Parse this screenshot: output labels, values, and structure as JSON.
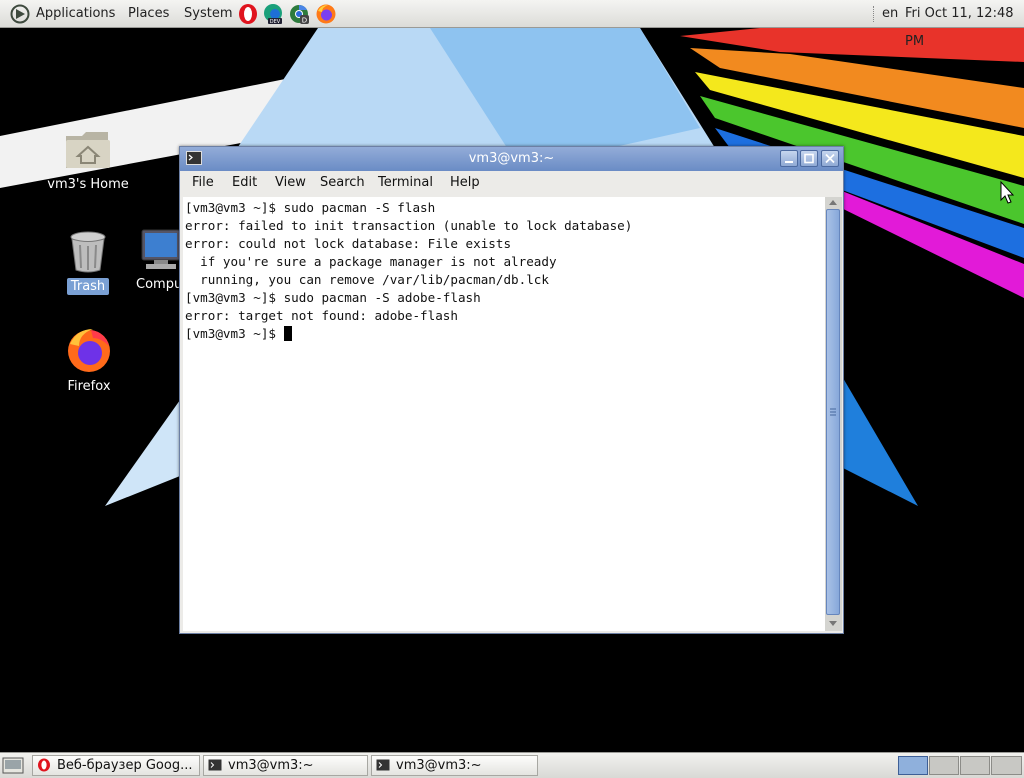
{
  "top_panel": {
    "menus": [
      "Applications",
      "Places",
      "System"
    ],
    "launchers": [
      "opera-icon",
      "edge-dev-icon",
      "chrome-dev-icon",
      "firefox-icon"
    ],
    "keyboard_layout": "en",
    "clock": "Fri Oct 11, 12:48 PM"
  },
  "desktop": {
    "icons": [
      {
        "label": "vm3's Home",
        "icon": "home-folder-icon"
      },
      {
        "label": "Trash",
        "icon": "trash-icon"
      },
      {
        "label": "Compu",
        "icon": "computer-icon"
      },
      {
        "label": "Firefox",
        "icon": "firefox-icon"
      }
    ]
  },
  "terminal": {
    "title": "vm3@vm3:~",
    "menu": [
      "File",
      "Edit",
      "View",
      "Search",
      "Terminal",
      "Help"
    ],
    "lines": [
      "[vm3@vm3 ~]$ sudo pacman -S flash",
      "error: failed to init transaction (unable to lock database)",
      "error: could not lock database: File exists",
      "  if you're sure a package manager is not already",
      "  running, you can remove /var/lib/pacman/db.lck",
      "[vm3@vm3 ~]$ sudo pacman -S adobe-flash",
      "error: target not found: adobe-flash"
    ],
    "prompt": "[vm3@vm3 ~]$ "
  },
  "taskbar": {
    "tasks": [
      {
        "label": "Веб-браузер Goog...",
        "icon": "opera-icon"
      },
      {
        "label": "vm3@vm3:~",
        "icon": "terminal-icon"
      },
      {
        "label": "vm3@vm3:~",
        "icon": "terminal-icon"
      }
    ],
    "active_workspace": 1
  },
  "colors": {
    "titlebar": "#6a8cc5",
    "selection": "#7aa0d4",
    "panel": "#e6e6e2"
  }
}
